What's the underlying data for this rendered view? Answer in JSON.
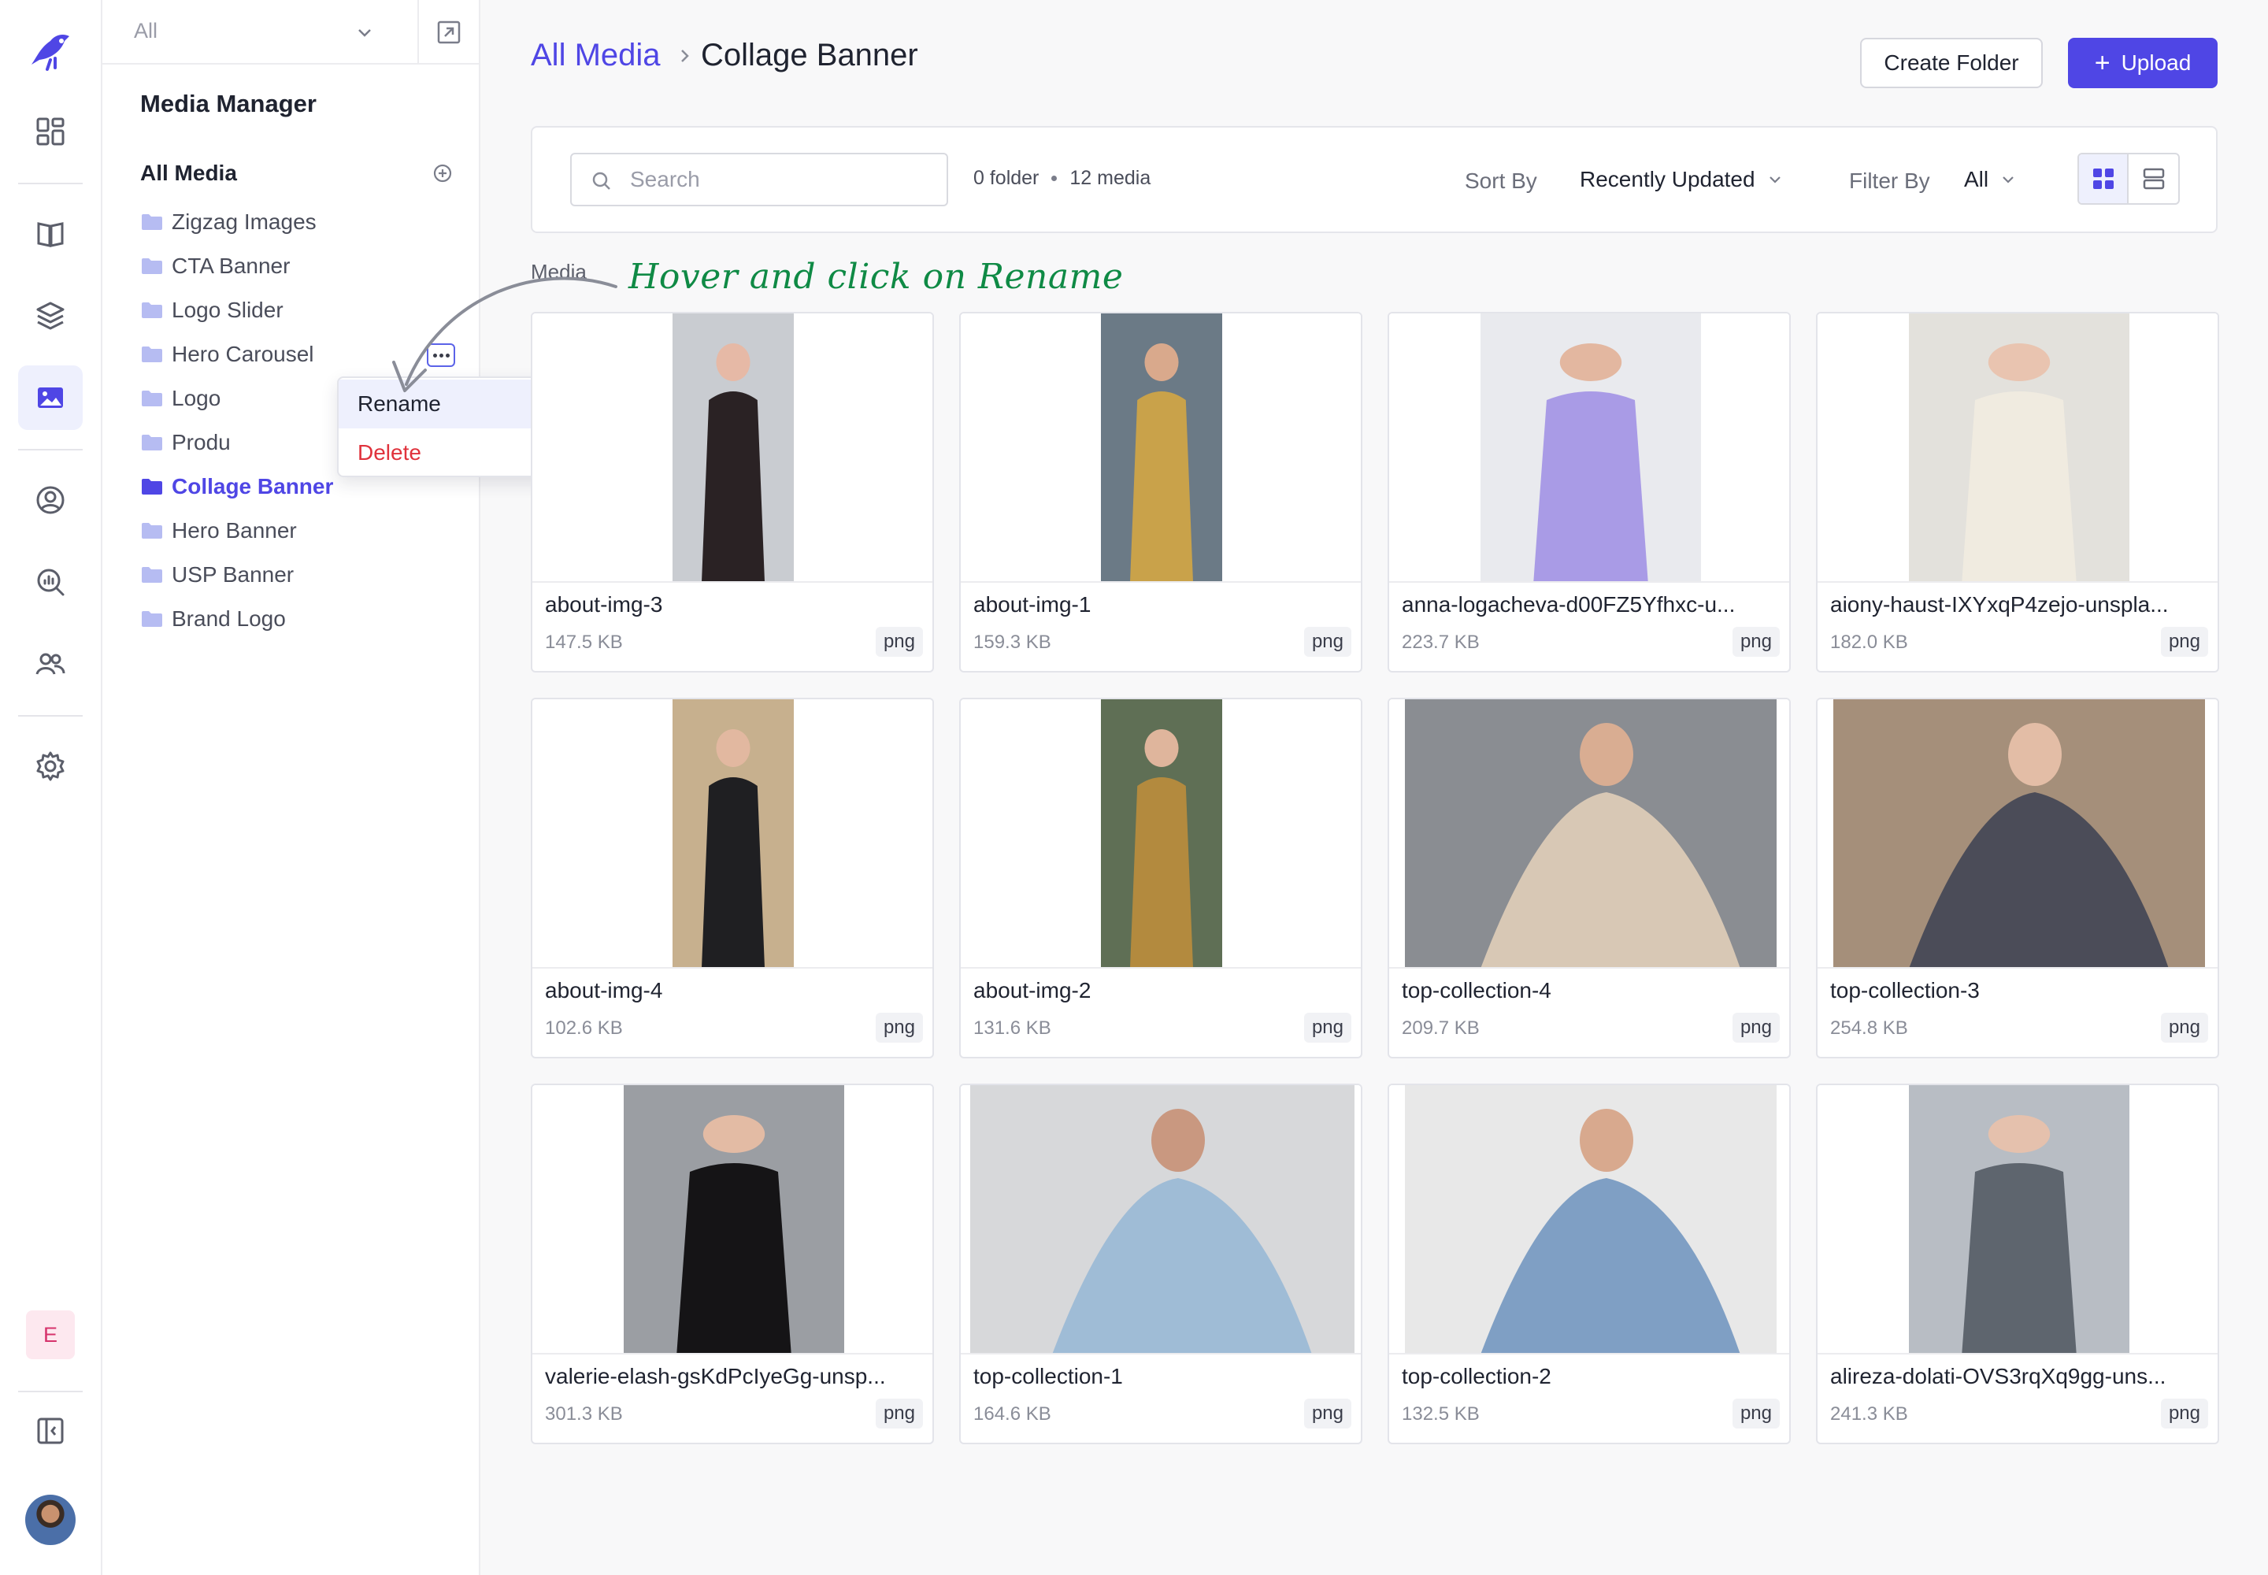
{
  "rail": {
    "items": [
      {
        "icon": "dashboard-icon"
      },
      {
        "icon": "book-icon"
      },
      {
        "icon": "layers-icon"
      },
      {
        "icon": "image-icon",
        "active": true
      },
      {
        "icon": "user-circle-icon"
      },
      {
        "icon": "analytics-icon"
      },
      {
        "icon": "team-icon"
      },
      {
        "icon": "gear-icon"
      }
    ],
    "env_badge": "E"
  },
  "sidebar": {
    "filter_value": "All",
    "title": "Media Manager",
    "all_media": "All Media",
    "folders": [
      {
        "label": "Zigzag Images"
      },
      {
        "label": "CTA Banner"
      },
      {
        "label": "Logo Slider"
      },
      {
        "label": "Hero Carousel"
      },
      {
        "label": "Logo"
      },
      {
        "label": "Produ"
      },
      {
        "label": "Collage Banner",
        "active": true
      },
      {
        "label": "Hero Banner"
      },
      {
        "label": "USP Banner"
      },
      {
        "label": "Brand Logo"
      }
    ],
    "context_menu": {
      "rename": "Rename",
      "delete": "Delete"
    }
  },
  "header": {
    "breadcrumb_root": "All Media",
    "breadcrumb_current": "Collage Banner",
    "create_folder": "Create Folder",
    "upload": "Upload"
  },
  "toolbar": {
    "search_placeholder": "Search",
    "folder_count": "0 folder",
    "media_count": "12 media",
    "sort_label": "Sort By",
    "sort_value": "Recently Updated",
    "filter_label": "Filter By",
    "filter_value": "All"
  },
  "section_label": "Media",
  "annotation": "Hover and click on Rename",
  "colors": {
    "accent": "#4f46e5",
    "annotation": "#0f8a45",
    "danger": "#e0323c"
  },
  "media": [
    {
      "name": "about-img-3",
      "size": "147.5 KB",
      "ext": "png"
    },
    {
      "name": "about-img-1",
      "size": "159.3 KB",
      "ext": "png"
    },
    {
      "name": "anna-logacheva-d00FZ5Yfhxc-u...",
      "size": "223.7 KB",
      "ext": "png"
    },
    {
      "name": "aiony-haust-IXYxqP4zejo-unspla...",
      "size": "182.0 KB",
      "ext": "png"
    },
    {
      "name": "about-img-4",
      "size": "102.6 KB",
      "ext": "png"
    },
    {
      "name": "about-img-2",
      "size": "131.6 KB",
      "ext": "png"
    },
    {
      "name": "top-collection-4",
      "size": "209.7 KB",
      "ext": "png"
    },
    {
      "name": "top-collection-3",
      "size": "254.8 KB",
      "ext": "png"
    },
    {
      "name": "valerie-elash-gsKdPcIyeGg-unsp...",
      "size": "301.3 KB",
      "ext": "png"
    },
    {
      "name": "top-collection-1",
      "size": "164.6 KB",
      "ext": "png"
    },
    {
      "name": "top-collection-2",
      "size": "132.5 KB",
      "ext": "png"
    },
    {
      "name": "alireza-dolati-OVS3rqXq9gg-uns...",
      "size": "241.3 KB",
      "ext": "png"
    }
  ]
}
